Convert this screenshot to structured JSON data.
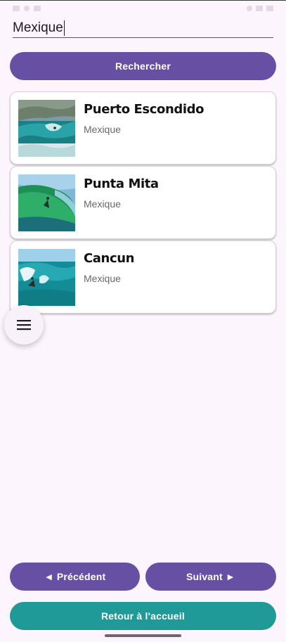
{
  "search": {
    "value": "Mexique",
    "button_label": "Rechercher"
  },
  "results": [
    {
      "title": "Puerto Escondido",
      "country": "Mexique",
      "image_icon": "wave-photo"
    },
    {
      "title": "Punta Mita",
      "country": "Mexique",
      "image_icon": "wave-photo"
    },
    {
      "title": "Cancun",
      "country": "Mexique",
      "image_icon": "wave-photo"
    }
  ],
  "menu": {
    "icon": "hamburger-menu-icon"
  },
  "pagination": {
    "prev_label": "◄ Précédent",
    "next_label": "Suivant ►"
  },
  "home": {
    "label": "Retour à l'accueil"
  },
  "colors": {
    "primary": "#6750a4",
    "secondary": "#1f9a98",
    "background": "#fdf5fd"
  }
}
